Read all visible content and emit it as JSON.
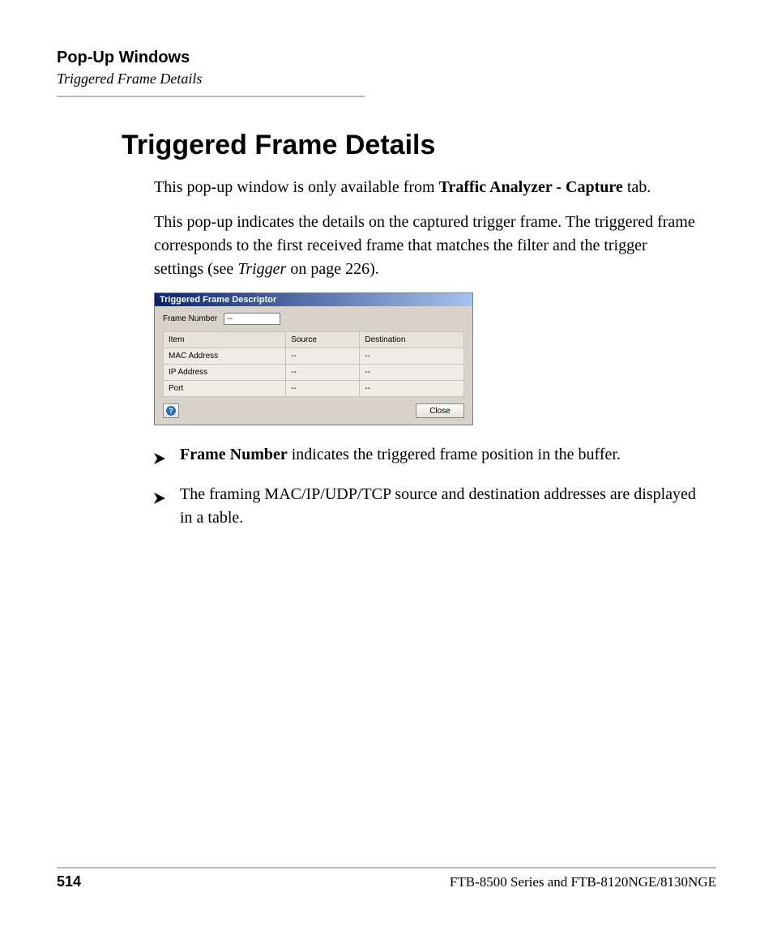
{
  "running_head": {
    "title": "Pop-Up Windows",
    "subtitle": "Triggered Frame Details"
  },
  "main": {
    "title": "Triggered Frame Details",
    "p1_pre": "This pop-up window is only available from ",
    "p1_bold": "Traffic Analyzer - Capture",
    "p1_post": " tab.",
    "p2_a": "This pop-up indicates the details on the captured trigger frame. The triggered frame corresponds to the first received frame that matches the filter and the trigger settings (see ",
    "p2_ital": "Trigger",
    "p2_b": " on page 226)."
  },
  "popup": {
    "title": "Triggered Frame Descriptor",
    "frame_number_label": "Frame Number",
    "frame_number_value": "--",
    "headers": {
      "item": "Item",
      "source": "Source",
      "destination": "Destination"
    },
    "rows": [
      {
        "item": "MAC Address",
        "source": "--",
        "destination": "--"
      },
      {
        "item": "IP Address",
        "source": "--",
        "destination": "--"
      },
      {
        "item": "Port",
        "source": "--",
        "destination": "--"
      }
    ],
    "help_glyph": "?",
    "close_label": "Close"
  },
  "bullets": {
    "b1_bold": "Frame Number",
    "b1_rest": " indicates the triggered frame position in the buffer.",
    "b2": "The framing MAC/IP/UDP/TCP source and destination addresses are displayed in a table."
  },
  "footer": {
    "page": "514",
    "doc": "FTB-8500 Series and FTB-8120NGE/8130NGE"
  }
}
